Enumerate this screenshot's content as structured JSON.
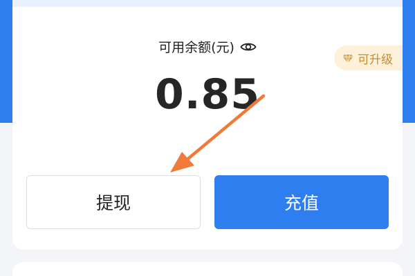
{
  "wallet": {
    "balance_label": "可用余额(元)",
    "balance_amount": "0.85",
    "upgrade_badge": "可升级"
  },
  "actions": {
    "withdraw_label": "提现",
    "recharge_label": "充值"
  },
  "colors": {
    "primary": "#2f7ef0",
    "badge_bg": "#fdf1dc",
    "badge_text": "#c98b2b",
    "arrow": "#f07a3a"
  },
  "icons": {
    "visibility": "eye-icon",
    "badge": "diamond-icon"
  }
}
